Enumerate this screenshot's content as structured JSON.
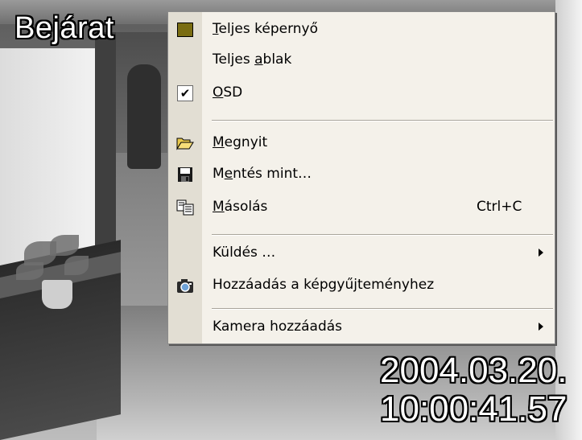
{
  "video": {
    "camera_name": "Bejárat",
    "date": "2004.03.20.",
    "time": "10:00:41.57"
  },
  "menu": {
    "items": [
      {
        "label_underline": "T",
        "label_rest": "eljes képernyő",
        "icon": "color-square-icon",
        "shortcut": ""
      },
      {
        "label_pre": "Teljes ",
        "label_underline": "a",
        "label_rest": "blak",
        "icon": "",
        "shortcut": ""
      },
      {
        "label_underline": "O",
        "label_rest": "SD",
        "icon": "checkmark-icon",
        "checked": true,
        "shortcut": ""
      },
      {
        "label_underline": "M",
        "label_rest": "egnyit",
        "icon": "open-folder-icon",
        "shortcut": ""
      },
      {
        "label_pre": "M",
        "label_underline": "e",
        "label_rest": "ntés mint…",
        "icon": "floppy-disk-icon",
        "shortcut": ""
      },
      {
        "label_underline": "M",
        "label_rest": "ásolás",
        "icon": "copy-icon",
        "shortcut": "Ctrl+C"
      },
      {
        "label": "Küldés …",
        "icon": "",
        "submenu": true
      },
      {
        "label": "Hozzáadás a képgyűjteményhez",
        "icon": "camera-icon"
      },
      {
        "label": "Kamera hozzáadás",
        "icon": "",
        "submenu": true
      }
    ]
  },
  "colors": {
    "menu_bg": "#f4f1ea",
    "gutter_bg": "#e2ded3",
    "square_icon": "#7a6d12"
  }
}
